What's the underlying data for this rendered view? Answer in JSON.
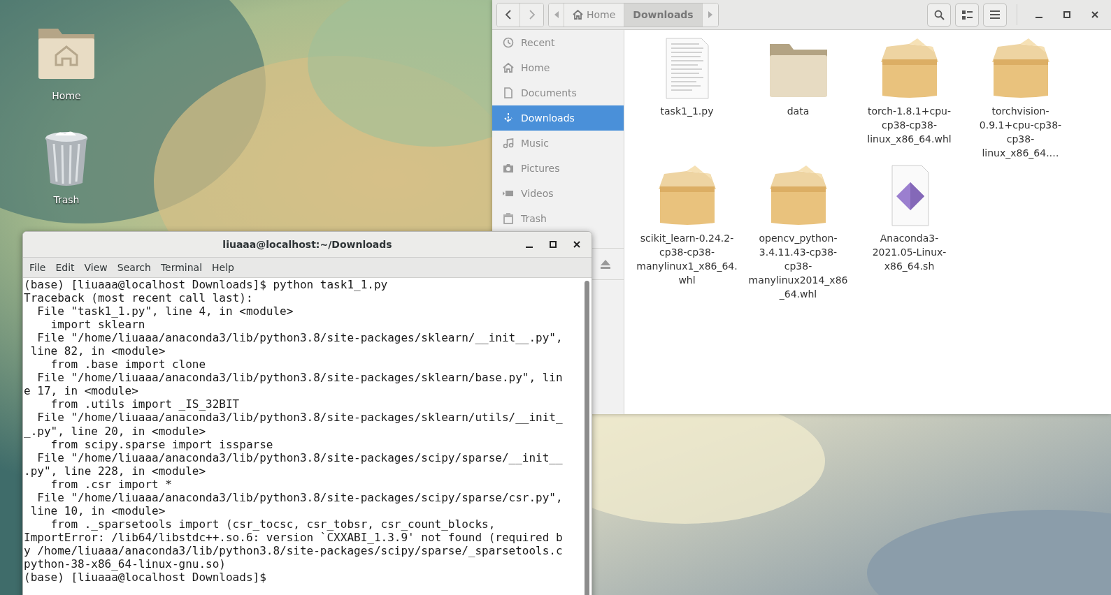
{
  "desktop": {
    "icons": [
      {
        "label": "Home",
        "kind": "folder"
      },
      {
        "label": "Trash",
        "kind": "trash"
      }
    ]
  },
  "file_manager": {
    "path": [
      {
        "label": "Home",
        "selected": false
      },
      {
        "label": "Downloads",
        "selected": true
      }
    ],
    "sidebar": {
      "items": [
        {
          "label": "Recent",
          "selected": false
        },
        {
          "label": "Home",
          "selected": false
        },
        {
          "label": "Documents",
          "selected": false
        },
        {
          "label": "Downloads",
          "selected": true
        },
        {
          "label": "Music",
          "selected": false
        },
        {
          "label": "Pictures",
          "selected": false
        },
        {
          "label": "Videos",
          "selected": false
        },
        {
          "label": "Trash",
          "selected": false
        }
      ]
    },
    "files": [
      {
        "name": "task1_1.py",
        "kind": "text"
      },
      {
        "name": "data",
        "kind": "folder"
      },
      {
        "name": "torch-1.8.1+cpu-cp38-cp38-linux_x86_64.whl",
        "kind": "package"
      },
      {
        "name": "torchvision-0.9.1+cpu-cp38-cp38-linux_x86_64.…",
        "kind": "package"
      },
      {
        "name": "scikit_learn-0.24.2-cp38-cp38-manylinux1_x86_64.whl",
        "kind": "package"
      },
      {
        "name": "opencv_python-3.4.11.43-cp38-cp38-manylinux2014_x86_64.whl",
        "kind": "package"
      },
      {
        "name": "Anaconda3-2021.05-Linux-x86_64.sh",
        "kind": "script"
      }
    ]
  },
  "terminal": {
    "title": "liuaaa@localhost:~/Downloads",
    "menu": [
      "File",
      "Edit",
      "View",
      "Search",
      "Terminal",
      "Help"
    ],
    "lines": [
      "(base) [liuaaa@localhost Downloads]$ python task1_1.py",
      "Traceback (most recent call last):",
      "  File \"task1_1.py\", line 4, in <module>",
      "    import sklearn",
      "  File \"/home/liuaaa/anaconda3/lib/python3.8/site-packages/sklearn/__init__.py\",",
      " line 82, in <module>",
      "    from .base import clone",
      "  File \"/home/liuaaa/anaconda3/lib/python3.8/site-packages/sklearn/base.py\", lin",
      "e 17, in <module>",
      "    from .utils import _IS_32BIT",
      "  File \"/home/liuaaa/anaconda3/lib/python3.8/site-packages/sklearn/utils/__init_",
      "_.py\", line 20, in <module>",
      "    from scipy.sparse import issparse",
      "  File \"/home/liuaaa/anaconda3/lib/python3.8/site-packages/scipy/sparse/__init__",
      ".py\", line 228, in <module>",
      "    from .csr import *",
      "  File \"/home/liuaaa/anaconda3/lib/python3.8/site-packages/scipy/sparse/csr.py\",",
      " line 10, in <module>",
      "    from ._sparsetools import (csr_tocsc, csr_tobsr, csr_count_blocks,",
      "ImportError: /lib64/libstdc++.so.6: version `CXXABI_1.3.9' not found (required b",
      "y /home/liuaaa/anaconda3/lib/python3.8/site-packages/scipy/sparse/_sparsetools.c",
      "python-38-x86_64-linux-gnu.so)",
      "(base) [liuaaa@localhost Downloads]$"
    ]
  }
}
